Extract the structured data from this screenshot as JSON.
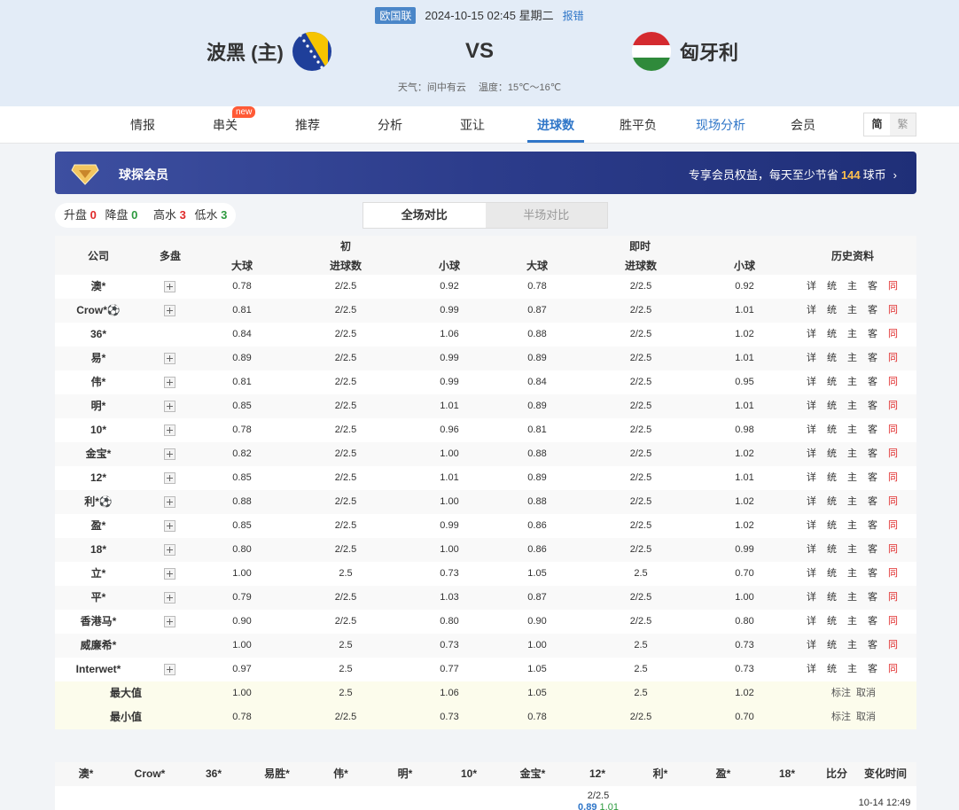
{
  "match": {
    "league": "欧国联",
    "datetime": "2024-10-15 02:45 星期二",
    "report": "报错",
    "home": "波黑 (主)",
    "vs": "VS",
    "away": "匈牙利",
    "weather": "天气：间中有云",
    "temperature": "温度：15℃～16℃"
  },
  "nav": {
    "tabs": [
      "情报",
      "串关",
      "推荐",
      "分析",
      "亚让",
      "进球数",
      "胜平负",
      "现场分析",
      "会员"
    ],
    "new_badge": "new",
    "lang_simplified": "简",
    "lang_traditional": "繁"
  },
  "banner": {
    "title": "球探会员",
    "promo_prefix": "专享会员权益，每天至少节省",
    "promo_amount": "144",
    "promo_suffix": "球币",
    "chevron": "›"
  },
  "stats": {
    "up_label": "升盘",
    "up": "0",
    "down_label": "降盘",
    "down": "0",
    "high_label": "高水",
    "high": "3",
    "low_label": "低水",
    "low": "3"
  },
  "segment": {
    "full": "全场对比",
    "half": "半场对比"
  },
  "table": {
    "headers": {
      "company": "公司",
      "multi": "多盘",
      "initial": "初",
      "live": "即时",
      "big": "大球",
      "goals": "进球数",
      "small": "小球",
      "history": "历史资料"
    },
    "history_links": [
      "详",
      "统",
      "主",
      "客",
      "同"
    ],
    "rows": [
      {
        "company": "澳*",
        "plus": true,
        "ib": "0.78",
        "ig": "2/2.5",
        "is": "0.92",
        "lb": "0.78",
        "lg": "2/2.5",
        "ls": "0.92"
      },
      {
        "company": "Crow*⚽",
        "plus": true,
        "ib": "0.81",
        "ig": "2/2.5",
        "is": "0.99",
        "lb": "0.87",
        "lg": "2/2.5",
        "ls": "1.01"
      },
      {
        "company": "36*",
        "plus": false,
        "ib": "0.84",
        "ig": "2/2.5",
        "is": "1.06",
        "lb": "0.88",
        "lg": "2/2.5",
        "ls": "1.02"
      },
      {
        "company": "易*",
        "plus": true,
        "ib": "0.89",
        "ig": "2/2.5",
        "is": "0.99",
        "lb": "0.89",
        "lg": "2/2.5",
        "ls": "1.01"
      },
      {
        "company": "伟*",
        "plus": true,
        "ib": "0.81",
        "ig": "2/2.5",
        "is": "0.99",
        "lb": "0.84",
        "lg": "2/2.5",
        "ls": "0.95"
      },
      {
        "company": "明*",
        "plus": true,
        "ib": "0.85",
        "ig": "2/2.5",
        "is": "1.01",
        "lb": "0.89",
        "lg": "2/2.5",
        "ls": "1.01"
      },
      {
        "company": "10*",
        "plus": true,
        "ib": "0.78",
        "ig": "2/2.5",
        "is": "0.96",
        "lb": "0.81",
        "lg": "2/2.5",
        "ls": "0.98"
      },
      {
        "company": "金宝*",
        "plus": true,
        "ib": "0.82",
        "ig": "2/2.5",
        "is": "1.00",
        "lb": "0.88",
        "lg": "2/2.5",
        "ls": "1.02"
      },
      {
        "company": "12*",
        "plus": true,
        "ib": "0.85",
        "ig": "2/2.5",
        "is": "1.01",
        "lb": "0.89",
        "lg": "2/2.5",
        "ls": "1.01"
      },
      {
        "company": "利*⚽",
        "plus": true,
        "ib": "0.88",
        "ig": "2/2.5",
        "is": "1.00",
        "lb": "0.88",
        "lg": "2/2.5",
        "ls": "1.02"
      },
      {
        "company": "盈*",
        "plus": true,
        "ib": "0.85",
        "ig": "2/2.5",
        "is": "0.99",
        "lb": "0.86",
        "lg": "2/2.5",
        "ls": "1.02"
      },
      {
        "company": "18*",
        "plus": true,
        "ib": "0.80",
        "ig": "2/2.5",
        "is": "1.00",
        "lb": "0.86",
        "lg": "2/2.5",
        "ls": "0.99"
      },
      {
        "company": "立*",
        "plus": true,
        "ib": "1.00",
        "ig": "2.5",
        "is": "0.73",
        "lb": "1.05",
        "lg": "2.5",
        "ls": "0.70"
      },
      {
        "company": "平*",
        "plus": true,
        "ib": "0.79",
        "ig": "2/2.5",
        "is": "1.03",
        "lb": "0.87",
        "lg": "2/2.5",
        "ls": "1.00"
      },
      {
        "company": "香港马*",
        "plus": true,
        "ib": "0.90",
        "ig": "2/2.5",
        "is": "0.80",
        "lb": "0.90",
        "lg": "2/2.5",
        "ls": "0.80"
      },
      {
        "company": "威廉希*",
        "plus": false,
        "ib": "1.00",
        "ig": "2.5",
        "is": "0.73",
        "lb": "1.00",
        "lg": "2.5",
        "ls": "0.73"
      },
      {
        "company": "Interwet*",
        "plus": true,
        "ib": "0.97",
        "ig": "2.5",
        "is": "0.77",
        "lb": "1.05",
        "lg": "2.5",
        "ls": "0.73"
      }
    ],
    "summary": [
      {
        "label": "最大值",
        "ib": "1.00",
        "ig": "2.5",
        "is": "1.06",
        "lb": "1.05",
        "lg": "2.5",
        "ls": "1.02"
      },
      {
        "label": "最小值",
        "ib": "0.78",
        "ig": "2/2.5",
        "is": "0.73",
        "lb": "0.78",
        "lg": "2/2.5",
        "ls": "0.70"
      }
    ],
    "mark_label": "标注",
    "cancel_label": "取消"
  },
  "bottom": {
    "headers": [
      "澳*",
      "Crow*",
      "36*",
      "易胜*",
      "伟*",
      "明*",
      "10*",
      "金宝*",
      "12*",
      "利*",
      "盈*",
      "18*",
      "比分",
      "变化时间"
    ],
    "cell_goals": "2/2.5",
    "cell_big": "0.89",
    "cell_small": "1.01",
    "time": "10-14 12:49"
  },
  "colors": {
    "accent": "#2f76c8",
    "red": "#e02b2b",
    "green": "#2d9a3f",
    "banner": "#2c3c8b",
    "gold": "#ffc04d"
  }
}
